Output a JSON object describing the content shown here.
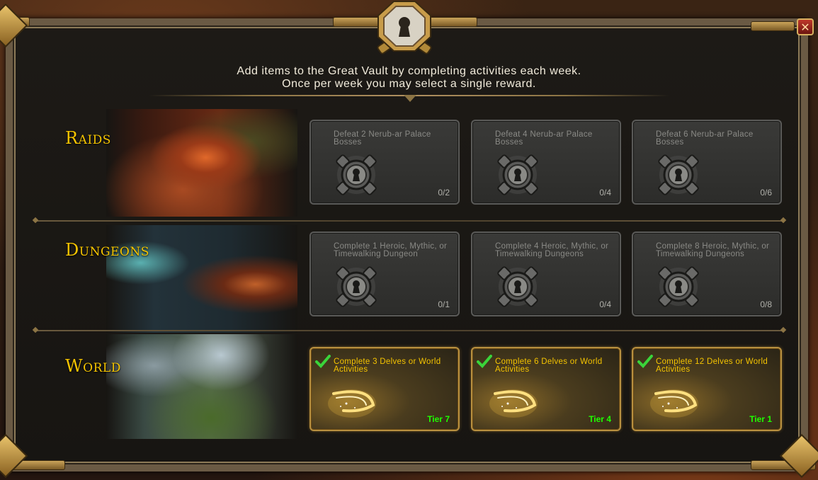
{
  "window": {
    "close_label": "✕",
    "intro_line1": "Add items to the Great Vault by completing activities each week.",
    "intro_line2": "Once per week you may select a single reward."
  },
  "rows": [
    {
      "title": "Raids",
      "cards": [
        {
          "label": "Defeat 2 Nerub-ar Palace Bosses",
          "progress": "0/2"
        },
        {
          "label": "Defeat 4 Nerub-ar Palace Bosses",
          "progress": "0/4"
        },
        {
          "label": "Defeat 6 Nerub-ar Palace Bosses",
          "progress": "0/6"
        }
      ]
    },
    {
      "title": "Dungeons",
      "cards": [
        {
          "label": "Complete 1 Heroic, Mythic, or Timewalking Dungeon",
          "progress": "0/1"
        },
        {
          "label": "Complete 4 Heroic, Mythic, or Timewalking Dungeons",
          "progress": "0/4"
        },
        {
          "label": "Complete 8 Heroic, Mythic, or Timewalking Dungeons",
          "progress": "0/8"
        }
      ]
    },
    {
      "title": "World",
      "cards": [
        {
          "label": "Complete 3 Delves or World Activities",
          "tier": "Tier 7"
        },
        {
          "label": "Complete 6 Delves or World Activities",
          "tier": "Tier 4"
        },
        {
          "label": "Complete 12 Delves or World Activities",
          "tier": "Tier 1"
        }
      ]
    }
  ],
  "colors": {
    "row_title": "#f5c400",
    "completed_label": "#f5c400",
    "tier_text": "#1eff00",
    "locked_label": "#8a8a86"
  },
  "icons": [
    "vault-lock-icon",
    "close-icon",
    "padlock-icon",
    "checkmark-icon",
    "reward-swirl-icon"
  ]
}
